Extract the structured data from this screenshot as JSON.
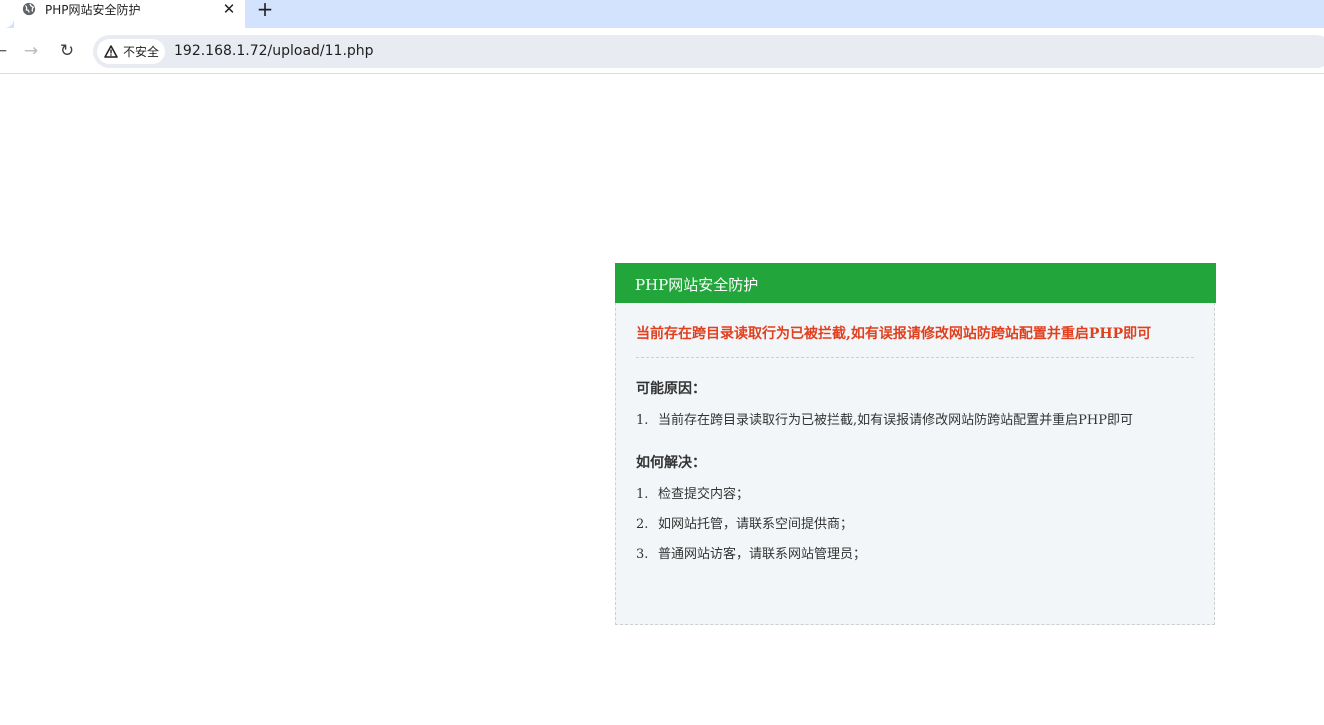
{
  "browser": {
    "tab": {
      "title": "PHP网站安全防护",
      "close_glyph": "✕"
    },
    "new_tab_glyph": "+",
    "nav": {
      "back_glyph": "←",
      "forward_glyph": "→",
      "reload_glyph": "↻"
    },
    "address_bar": {
      "security_label": "不安全",
      "url": "192.168.1.72/upload/11.php"
    }
  },
  "page": {
    "panel_title": "PHP网站安全防护",
    "alert_message": "当前存在跨目录读取行为已被拦截,如有误报请修改网站防跨站配置并重启PHP即可",
    "causes": {
      "heading": "可能原因：",
      "items": [
        {
          "num": "1.",
          "text": "当前存在跨目录读取行为已被拦截,如有误报请修改网站防跨站配置并重启PHP即可"
        }
      ]
    },
    "solutions": {
      "heading": "如何解决：",
      "items": [
        {
          "num": "1.",
          "text": "检查提交内容；"
        },
        {
          "num": "2.",
          "text": "如网站托管，请联系空间提供商；"
        },
        {
          "num": "3.",
          "text": "普通网站访客，请联系网站管理员；"
        }
      ]
    }
  },
  "colors": {
    "header_green": "#22a63c",
    "alert_red": "#e1401f",
    "panel_background": "#f3f6f8"
  },
  "icons": [
    "globe-icon",
    "close-icon",
    "plus-icon",
    "back-arrow-icon",
    "forward-arrow-icon",
    "reload-icon",
    "warning-icon"
  ]
}
